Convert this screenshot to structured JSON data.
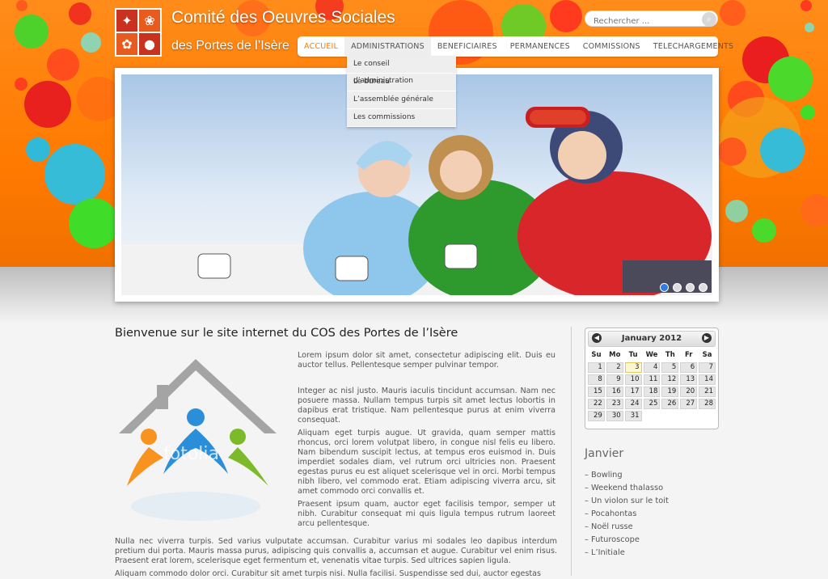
{
  "header": {
    "title": "Comité des Oeuvres Sociales",
    "subtitle": "des Portes de l’Isère",
    "colors": {
      "background": "#ff7a00",
      "accent": "#ff7a00"
    }
  },
  "search": {
    "placeholder": "Rechercher ...",
    "icon": "search-icon"
  },
  "nav": {
    "items": [
      "ACCUEIL",
      "ADMINISTRATIONS",
      "BENEFICIAIRES",
      "PERMANENCES",
      "COMMISSIONS",
      "TELECHARGEMENTS"
    ],
    "active": "ACCUEIL",
    "open": "ADMINISTRATIONS",
    "dropdown": [
      "Le conseil d’administration",
      "Le bureau",
      "L’assemblée générale",
      "Les commissions"
    ]
  },
  "slider": {
    "slide_count": 4,
    "active_slide": 1
  },
  "main": {
    "heading": "Bienvenue sur le site internet du COS des Portes de l’Isère",
    "logo_watermark": "fotolia",
    "paragraphs": [
      "Lorem ipsum dolor sit amet, consectetur adipiscing elit. Duis eu auctor tellus. Pellentesque semper pulvinar tempor.",
      "Integer ac nisl justo. Mauris iaculis tincidunt accumsan. Nam nec posuere massa. Nullam tempus turpis sit amet lectus lobortis in dapibus erat tristique. Nam pellentesque purus at enim viverra consequat.",
      "Aliquam eget turpis augue. Ut gravida, quam semper mattis rhoncus, orci lorem volutpat libero, in congue nisl felis eu libero. Nam bibendum suscipit lectus, at tempus eros euismod in. Duis imperdiet sodales diam, vel rutrum orci ultricies non. Praesent egestas purus eu est aliquet scelerisque vel in orci. Morbi tempus nibh libero, vel commodo erat. Etiam adipiscing viverra arcu, sit amet commodo orci convallis et.",
      "Praesent ipsum quam, auctor eget facilisis tempor, semper ut nibh. Curabitur consequat mi quis ligula tempus rutrum laoreet arcu pellentesque.",
      "Nulla nec viverra turpis. Sed varius vulputate accumsan. Curabitur varius mi sodales leo dapibus interdum pretium dui porta. Mauris massa purus, adipiscing quis convallis a, accumsan et augue. Curabitur vel enim risus. Praesent erat lorem, scelerisque eget fermentum et, venenatis vitae turpis. Sed ultrices sapien ligula.",
      "Aliquam commodo dolor orci. Curabitur sit amet turpis nisi. Nulla facilisi. Suspendisse sed dui, auctor egestas"
    ]
  },
  "calendar": {
    "month_label": "January 2012",
    "weekdays": [
      "Su",
      "Mo",
      "Tu",
      "We",
      "Th",
      "Fr",
      "Sa"
    ],
    "first_weekday_index": 0,
    "days_in_month": 31,
    "today": 3
  },
  "events": {
    "month": "Janvier",
    "items": [
      "Bowling",
      "Weekend thalasso",
      "Un violon sur le toit",
      "Pocahontas",
      "Noël russe",
      "Futuroscope",
      "L’Initiale"
    ]
  }
}
